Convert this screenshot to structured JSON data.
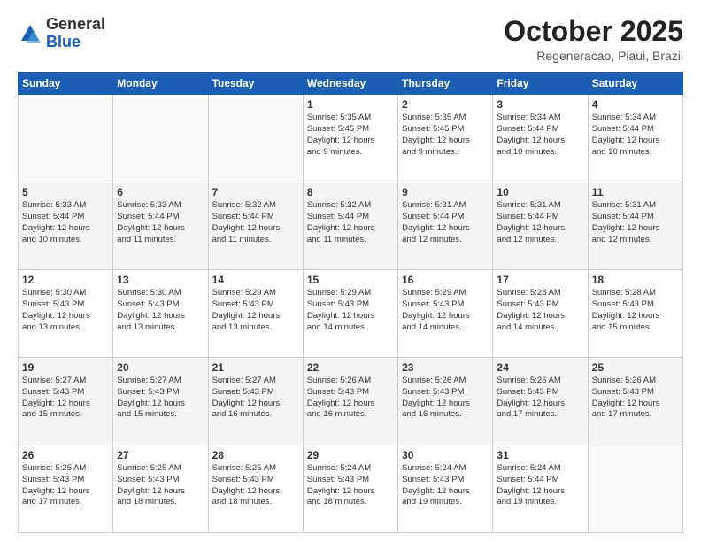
{
  "header": {
    "logo_general": "General",
    "logo_blue": "Blue",
    "month_title": "October 2025",
    "subtitle": "Regeneracao, Piaui, Brazil"
  },
  "weekdays": [
    "Sunday",
    "Monday",
    "Tuesday",
    "Wednesday",
    "Thursday",
    "Friday",
    "Saturday"
  ],
  "weeks": [
    [
      {
        "day": "",
        "detail": ""
      },
      {
        "day": "",
        "detail": ""
      },
      {
        "day": "",
        "detail": ""
      },
      {
        "day": "1",
        "detail": "Sunrise: 5:35 AM\nSunset: 5:45 PM\nDaylight: 12 hours\nand 9 minutes."
      },
      {
        "day": "2",
        "detail": "Sunrise: 5:35 AM\nSunset: 5:45 PM\nDaylight: 12 hours\nand 9 minutes."
      },
      {
        "day": "3",
        "detail": "Sunrise: 5:34 AM\nSunset: 5:44 PM\nDaylight: 12 hours\nand 10 minutes."
      },
      {
        "day": "4",
        "detail": "Sunrise: 5:34 AM\nSunset: 5:44 PM\nDaylight: 12 hours\nand 10 minutes."
      }
    ],
    [
      {
        "day": "5",
        "detail": "Sunrise: 5:33 AM\nSunset: 5:44 PM\nDaylight: 12 hours\nand 10 minutes."
      },
      {
        "day": "6",
        "detail": "Sunrise: 5:33 AM\nSunset: 5:44 PM\nDaylight: 12 hours\nand 11 minutes."
      },
      {
        "day": "7",
        "detail": "Sunrise: 5:32 AM\nSunset: 5:44 PM\nDaylight: 12 hours\nand 11 minutes."
      },
      {
        "day": "8",
        "detail": "Sunrise: 5:32 AM\nSunset: 5:44 PM\nDaylight: 12 hours\nand 11 minutes."
      },
      {
        "day": "9",
        "detail": "Sunrise: 5:31 AM\nSunset: 5:44 PM\nDaylight: 12 hours\nand 12 minutes."
      },
      {
        "day": "10",
        "detail": "Sunrise: 5:31 AM\nSunset: 5:44 PM\nDaylight: 12 hours\nand 12 minutes."
      },
      {
        "day": "11",
        "detail": "Sunrise: 5:31 AM\nSunset: 5:44 PM\nDaylight: 12 hours\nand 12 minutes."
      }
    ],
    [
      {
        "day": "12",
        "detail": "Sunrise: 5:30 AM\nSunset: 5:43 PM\nDaylight: 12 hours\nand 13 minutes."
      },
      {
        "day": "13",
        "detail": "Sunrise: 5:30 AM\nSunset: 5:43 PM\nDaylight: 12 hours\nand 13 minutes."
      },
      {
        "day": "14",
        "detail": "Sunrise: 5:29 AM\nSunset: 5:43 PM\nDaylight: 12 hours\nand 13 minutes."
      },
      {
        "day": "15",
        "detail": "Sunrise: 5:29 AM\nSunset: 5:43 PM\nDaylight: 12 hours\nand 14 minutes."
      },
      {
        "day": "16",
        "detail": "Sunrise: 5:29 AM\nSunset: 5:43 PM\nDaylight: 12 hours\nand 14 minutes."
      },
      {
        "day": "17",
        "detail": "Sunrise: 5:28 AM\nSunset: 5:43 PM\nDaylight: 12 hours\nand 14 minutes."
      },
      {
        "day": "18",
        "detail": "Sunrise: 5:28 AM\nSunset: 5:43 PM\nDaylight: 12 hours\nand 15 minutes."
      }
    ],
    [
      {
        "day": "19",
        "detail": "Sunrise: 5:27 AM\nSunset: 5:43 PM\nDaylight: 12 hours\nand 15 minutes."
      },
      {
        "day": "20",
        "detail": "Sunrise: 5:27 AM\nSunset: 5:43 PM\nDaylight: 12 hours\nand 15 minutes."
      },
      {
        "day": "21",
        "detail": "Sunrise: 5:27 AM\nSunset: 5:43 PM\nDaylight: 12 hours\nand 16 minutes."
      },
      {
        "day": "22",
        "detail": "Sunrise: 5:26 AM\nSunset: 5:43 PM\nDaylight: 12 hours\nand 16 minutes."
      },
      {
        "day": "23",
        "detail": "Sunrise: 5:26 AM\nSunset: 5:43 PM\nDaylight: 12 hours\nand 16 minutes."
      },
      {
        "day": "24",
        "detail": "Sunrise: 5:26 AM\nSunset: 5:43 PM\nDaylight: 12 hours\nand 17 minutes."
      },
      {
        "day": "25",
        "detail": "Sunrise: 5:26 AM\nSunset: 5:43 PM\nDaylight: 12 hours\nand 17 minutes."
      }
    ],
    [
      {
        "day": "26",
        "detail": "Sunrise: 5:25 AM\nSunset: 5:43 PM\nDaylight: 12 hours\nand 17 minutes."
      },
      {
        "day": "27",
        "detail": "Sunrise: 5:25 AM\nSunset: 5:43 PM\nDaylight: 12 hours\nand 18 minutes."
      },
      {
        "day": "28",
        "detail": "Sunrise: 5:25 AM\nSunset: 5:43 PM\nDaylight: 12 hours\nand 18 minutes."
      },
      {
        "day": "29",
        "detail": "Sunrise: 5:24 AM\nSunset: 5:43 PM\nDaylight: 12 hours\nand 18 minutes."
      },
      {
        "day": "30",
        "detail": "Sunrise: 5:24 AM\nSunset: 5:43 PM\nDaylight: 12 hours\nand 19 minutes."
      },
      {
        "day": "31",
        "detail": "Sunrise: 5:24 AM\nSunset: 5:44 PM\nDaylight: 12 hours\nand 19 minutes."
      },
      {
        "day": "",
        "detail": ""
      }
    ]
  ]
}
